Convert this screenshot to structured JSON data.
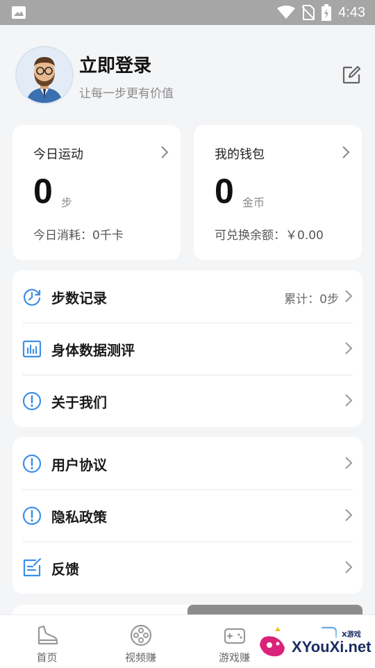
{
  "status_bar": {
    "time": "4:43"
  },
  "profile": {
    "title": "立即登录",
    "subtitle": "让每一步更有价值"
  },
  "stats": {
    "today": {
      "title": "今日运动",
      "value": "0",
      "unit": "步",
      "footer": "今日消耗：0千卡"
    },
    "wallet": {
      "title": "我的钱包",
      "value": "0",
      "unit": "金币",
      "footer": "可兑换余额：￥0.00"
    }
  },
  "menu_group1": [
    {
      "label": "步数记录",
      "right": "累计：0步",
      "icon": "clock-refresh-icon"
    },
    {
      "label": "身体数据测评",
      "right": "",
      "icon": "bar-chart-icon"
    },
    {
      "label": "关于我们",
      "right": "",
      "icon": "info-icon"
    }
  ],
  "menu_group2": [
    {
      "label": "用户协议",
      "icon": "info-icon"
    },
    {
      "label": "隐私政策",
      "icon": "info-icon"
    },
    {
      "label": "反馈",
      "icon": "feedback-edit-icon"
    }
  ],
  "tabs": [
    {
      "label": "首页",
      "icon": "sneaker-icon"
    },
    {
      "label": "视频赚",
      "icon": "film-reel-icon"
    },
    {
      "label": "游戏赚",
      "icon": "gamepad-icon"
    },
    {
      "label": "",
      "icon": "profile-icon"
    }
  ],
  "watermark": {
    "text": "XYouXi.net",
    "small": "X游戏"
  },
  "colors": {
    "accent": "#3d8fe8",
    "background": "#f4f5f7",
    "card": "#ffffff"
  }
}
